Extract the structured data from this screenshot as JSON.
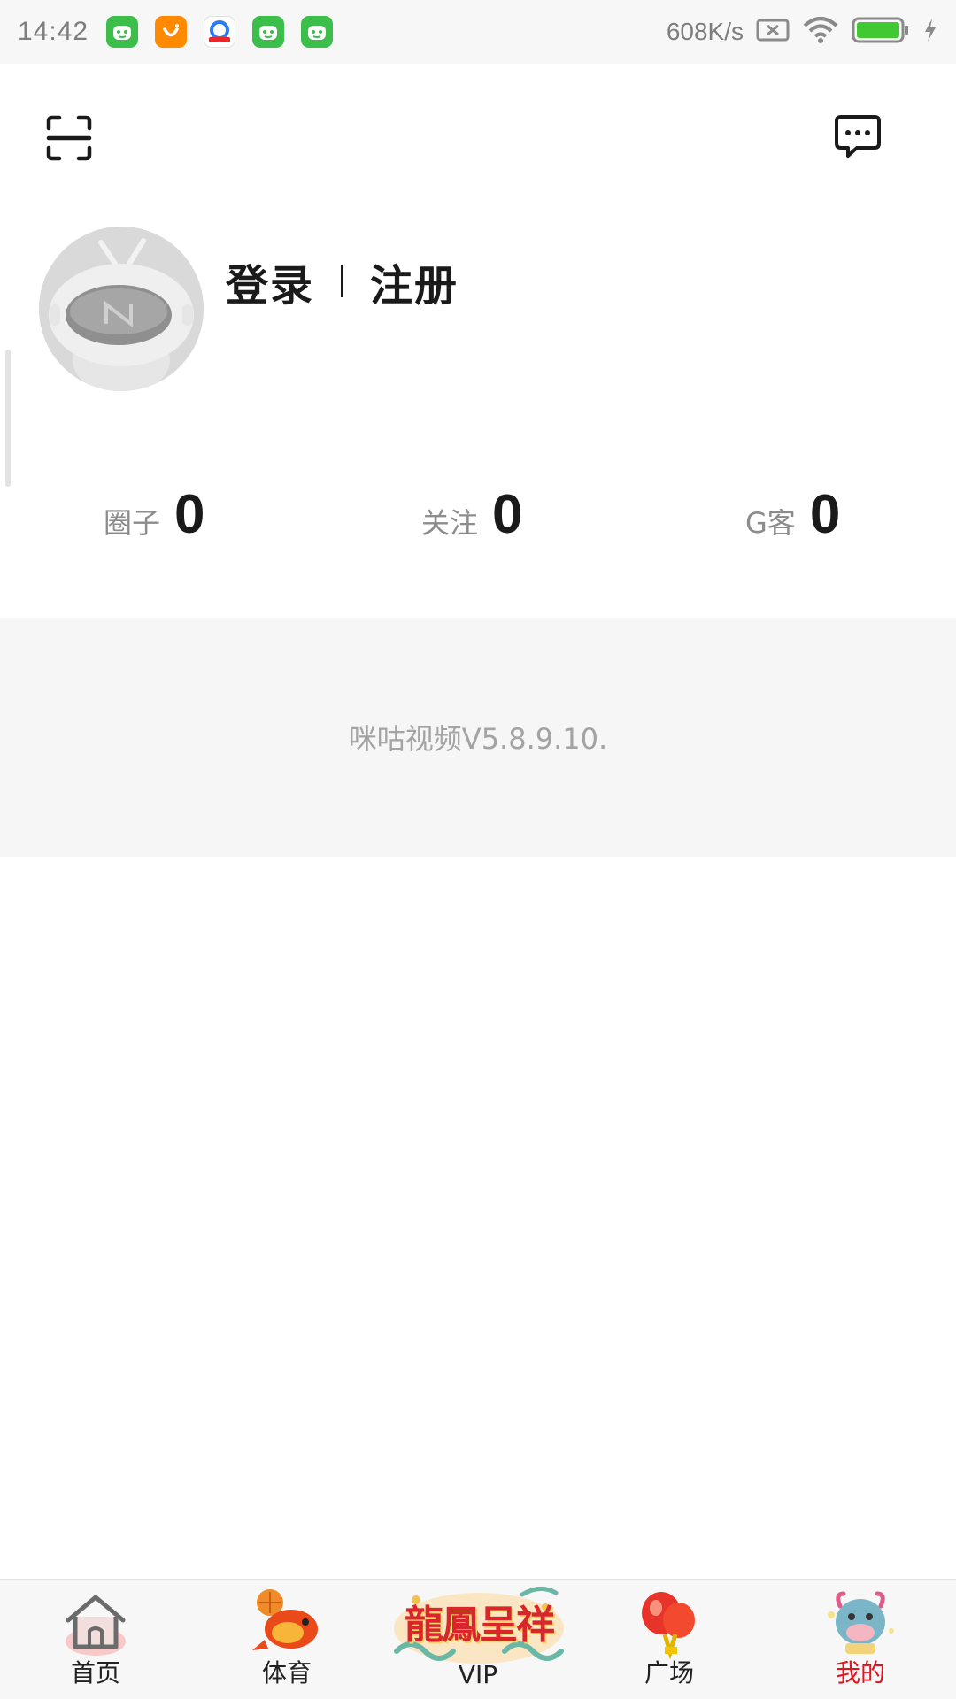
{
  "status_bar": {
    "time": "14:42",
    "network_speed": "608K/s",
    "battery": "100",
    "icons": [
      "app-green-icon",
      "app-orange-icon",
      "app-browser-icon",
      "app-green-icon",
      "app-green-icon",
      "no-sim-icon",
      "wifi-icon",
      "battery-icon",
      "charging-icon"
    ]
  },
  "header": {
    "scan_icon": "scan-icon",
    "message_icon": "message-icon"
  },
  "profile": {
    "login": "登录",
    "register": "注册"
  },
  "stats": [
    {
      "label": "圈子",
      "value": "0"
    },
    {
      "label": "关注",
      "value": "0"
    },
    {
      "label": "G客",
      "value": "0"
    }
  ],
  "version": "咪咕视频V5.8.9.10.",
  "bottom_nav": [
    {
      "label": "首页",
      "active": false
    },
    {
      "label": "体育",
      "active": false
    },
    {
      "label": "VIP",
      "active": false,
      "banner": "龍鳳呈祥"
    },
    {
      "label": "广场",
      "active": false
    },
    {
      "label": "我的",
      "active": true
    }
  ],
  "colors": {
    "active_tab": "#e0141e",
    "version_bg": "#f6f6f6",
    "status_bar_bg": "#f7f7f7"
  }
}
